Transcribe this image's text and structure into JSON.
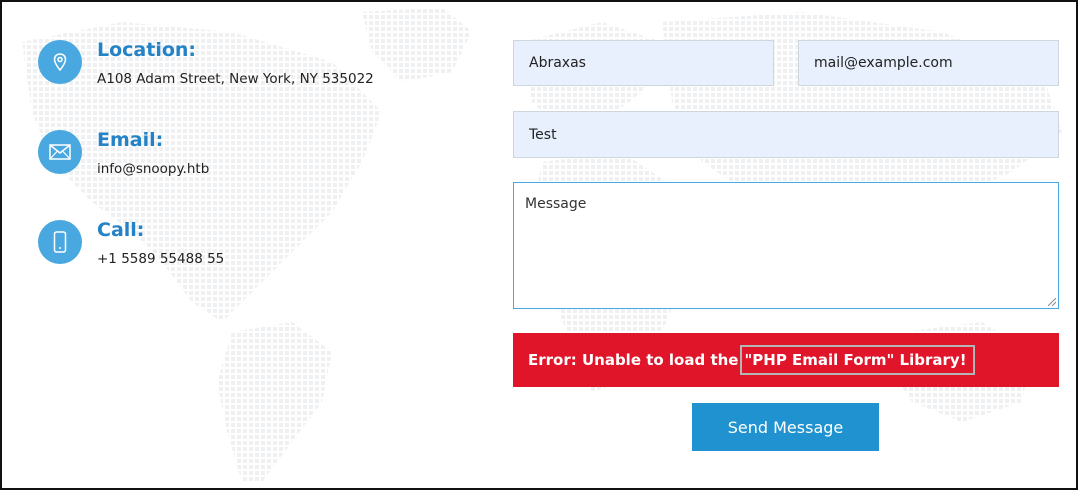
{
  "contact_info": {
    "location": {
      "title": "Location:",
      "text": "A108 Adam Street, New York, NY 535022",
      "icon": "map-pin-icon"
    },
    "email": {
      "title": "Email:",
      "text": "info@snoopy.htb",
      "icon": "envelope-icon"
    },
    "call": {
      "title": "Call:",
      "text": "+1 5589 55488 55",
      "icon": "phone-icon"
    }
  },
  "form": {
    "name_value": "Abraxas",
    "email_value": "mail@example.com",
    "subject_value": "Test",
    "message_placeholder": "Message",
    "error_prefix": "Error: Unable to load the ",
    "error_highlight": "\"PHP Email Form\" Library!",
    "send_label": "Send Message"
  },
  "colors": {
    "accent": "#4aa8e0",
    "title_blue": "#2482c6",
    "error_red": "#e0152a",
    "button_blue": "#2192d0",
    "field_bg": "#e8f0fe"
  }
}
